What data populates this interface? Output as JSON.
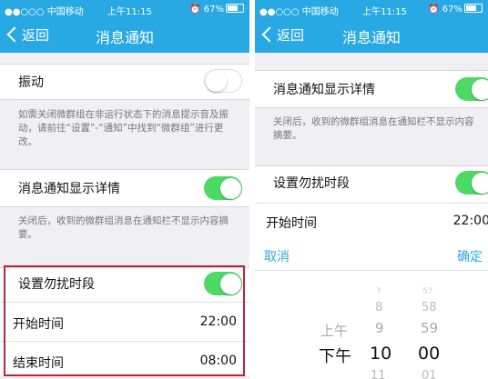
{
  "status_bar": {
    "carrier": "●●○○○ 中国移动",
    "time": "上午11:15",
    "battery": "67%"
  },
  "nav": {
    "back_label": "返回",
    "title": "消息通知"
  },
  "left": {
    "vibrate_label": "振动",
    "vibrate_on": false,
    "vibrate_note": "如需关闭微群组在非运行状态下的消息提示音及振动，请前往“设置”-“通知”中找到“微群组”进行更改。",
    "detail_label": "消息通知显示详情",
    "detail_on": true,
    "detail_note": "关闭后，收到的微群组消息在通知栏不显示内容摘要。",
    "dnd_label": "设置勿扰时段",
    "dnd_on": true,
    "start_label": "开始时间",
    "start_value": "22:00",
    "end_label": "结束时间",
    "end_value": "08:00"
  },
  "right": {
    "detail_label": "消息通知显示详情",
    "detail_on": true,
    "detail_note": "关闭后，收到的微群组消息在通知栏不显示内容摘要。",
    "dnd_label": "设置勿扰时段",
    "dnd_on": true,
    "start_label": "开始时间",
    "start_value": "22:00",
    "cancel_label": "取消",
    "ok_label": "确定",
    "picker": {
      "ampm": [
        "上午",
        "下午"
      ],
      "ampm_selected": "下午",
      "hours": [
        "7",
        "8",
        "9",
        "10",
        "11"
      ],
      "hour_selected": "10",
      "minutes": [
        "57",
        "58",
        "59",
        "00",
        "01"
      ],
      "minute_selected": "00"
    }
  },
  "colors": {
    "accent": "#29a9e4",
    "switch_on": "#4cd964",
    "highlight_box": "#c0213a"
  }
}
